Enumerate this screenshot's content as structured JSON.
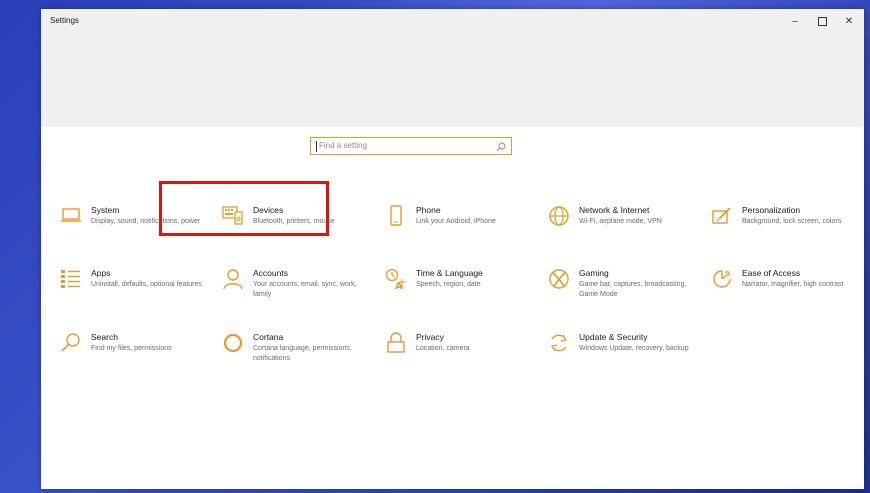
{
  "window": {
    "title": "Settings",
    "minimize_label": "–",
    "close_label": "✕"
  },
  "search": {
    "placeholder": "Find a setting"
  },
  "colors": {
    "accent": "#e89b2c",
    "highlight": "#e01313"
  },
  "tiles": [
    {
      "label": "System",
      "desc": "Display, sound, notifications, power",
      "icon": "laptop-icon"
    },
    {
      "label": "Devices",
      "desc": "Bluetooth, printers, mouse",
      "icon": "keyboard-icon"
    },
    {
      "label": "Phone",
      "desc": "Link your Android, iPhone",
      "icon": "phone-icon"
    },
    {
      "label": "Network & Internet",
      "desc": "Wi-Fi, airplane mode, VPN",
      "icon": "globe-icon"
    },
    {
      "label": "Personalization",
      "desc": "Background, lock screen, colors",
      "icon": "paint-icon"
    },
    {
      "label": "Apps",
      "desc": "Uninstall, defaults, optional features",
      "icon": "list-icon"
    },
    {
      "label": "Accounts",
      "desc": "Your accounts, email, sync, work, family",
      "icon": "person-icon"
    },
    {
      "label": "Time & Language",
      "desc": "Speech, region, date",
      "icon": "language-icon"
    },
    {
      "label": "Gaming",
      "desc": "Game bar, captures, broadcasting, Game Mode",
      "icon": "xbox-icon"
    },
    {
      "label": "Ease of Access",
      "desc": "Narrator, magnifier, high contrast",
      "icon": "ease-icon"
    },
    {
      "label": "Search",
      "desc": "Find my files, permissions",
      "icon": "search-icon"
    },
    {
      "label": "Cortana",
      "desc": "Cortana language, permissions, notifications",
      "icon": "cortana-icon"
    },
    {
      "label": "Privacy",
      "desc": "Location, camera",
      "icon": "lock-icon"
    },
    {
      "label": "Update & Security",
      "desc": "Windows Update, recovery, backup",
      "icon": "sync-icon"
    }
  ]
}
